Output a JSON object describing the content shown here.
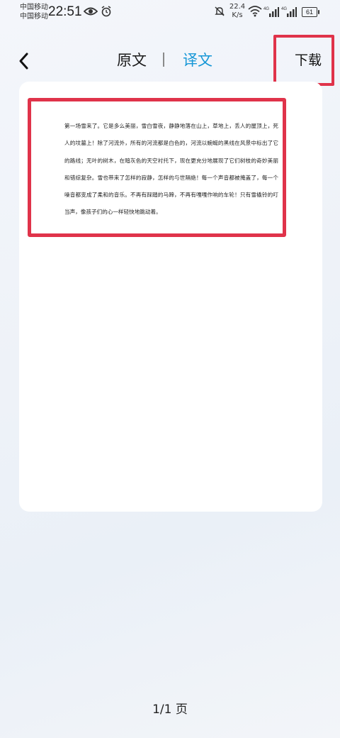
{
  "status_bar": {
    "carrier_1": "中国移动",
    "carrier_2": "中国移动",
    "time": "22:51",
    "net_speed_value": "22.4",
    "net_speed_unit": "K/s",
    "battery": "61",
    "icons": [
      "eye-icon",
      "alarm-off-icon",
      "mute-icon",
      "wifi-icon",
      "signal-4g-icon",
      "signal-4g-icon",
      "battery-icon"
    ]
  },
  "header": {
    "tab_original": "原文",
    "tab_translation": "译文",
    "divider": "|",
    "download_label": "下载",
    "active_tab_color": "#1596d6",
    "highlight_color": "#e0334a"
  },
  "document": {
    "text": "第一场雪来了。它是多么美丽，雪白雪夜，静静地落在山上，草地上，丢人的屋顶上，死人的坟墓上！除了河流外，所有的河流都是白色的，河流以蜿蜒的黑线在风景中标出了它的路线；无叶的树木，在暗灰色的天空衬托下，现在更充分地展现了它们树枝的奇妙美丽和错综复杂。雪也带来了怎样的寂静，怎样的与世隔绝！每一个声音都被掩盖了，每一个噪音都变成了柔和的音乐。不再有踩踏的马蹄，不再有嘎嘎作响的车轮！只有雪橇铃的叮当声，像孩子们的心一样轻快地跳动着。"
  },
  "footer": {
    "page_indicator": "1/1 页"
  }
}
